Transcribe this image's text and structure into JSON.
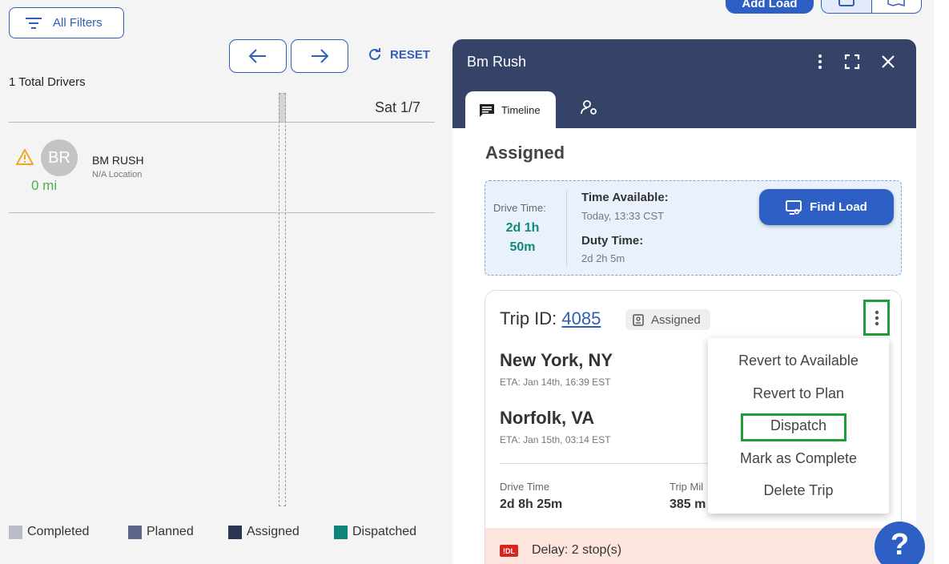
{
  "toolbar": {
    "filters_label": "All Filters",
    "reset_label": "RESET",
    "add_load_label": "Add Load"
  },
  "drivers": {
    "total_label": "1 Total Drivers",
    "date_column": "Sat 1/7",
    "list": [
      {
        "initials": "BR",
        "name": "BM RUSH",
        "location": "N/A Location",
        "miles": "0 mi"
      }
    ]
  },
  "legend": [
    {
      "label": "Completed",
      "color": "#b8bdc6"
    },
    {
      "label": "Planned",
      "color": "#5d6788"
    },
    {
      "label": "Assigned",
      "color": "#2d3554"
    },
    {
      "label": "Dispatched",
      "color": "#0f8478"
    }
  ],
  "panel": {
    "title": "Bm Rush",
    "tabs": [
      {
        "label": "Timeline"
      }
    ],
    "status_title": "Assigned",
    "availability": {
      "drive_time_label": "Drive Time:",
      "drive_time_value_1": "2d 1h",
      "drive_time_value_2": "50m",
      "time_available_label": "Time Available:",
      "time_available_value": "Today, 13:33 CST",
      "duty_time_label": "Duty Time:",
      "duty_time_value": "2d 2h 5m",
      "find_load_label": "Find Load"
    },
    "trip": {
      "id_label": "Trip ID:",
      "id_value": "4085",
      "status_badge": "Assigned",
      "stops": [
        {
          "city": "New York, NY",
          "eta": "ETA: Jan 14th, 16:39 EST"
        },
        {
          "city": "Norfolk, VA",
          "eta": "ETA: Jan 15th, 03:14 EST"
        }
      ],
      "drive_time_label": "Drive Time",
      "drive_time_value": "2d 8h 25m",
      "trip_miles_label": "Trip Mil",
      "trip_miles_value": "385 m",
      "delay_badge": "!DL",
      "delay_text": "Delay: 2 stop(s)"
    }
  },
  "context_menu": {
    "items": [
      "Revert to Available",
      "Revert to Plan",
      "Dispatch",
      "Mark as Complete",
      "Delete Trip"
    ],
    "highlight_color": "#1e9e3a"
  },
  "help": {
    "label": "?"
  },
  "colors": {
    "primary": "#2d5fc4",
    "header": "#354369",
    "teal": "#0d8a7a",
    "green": "#4caf50"
  }
}
